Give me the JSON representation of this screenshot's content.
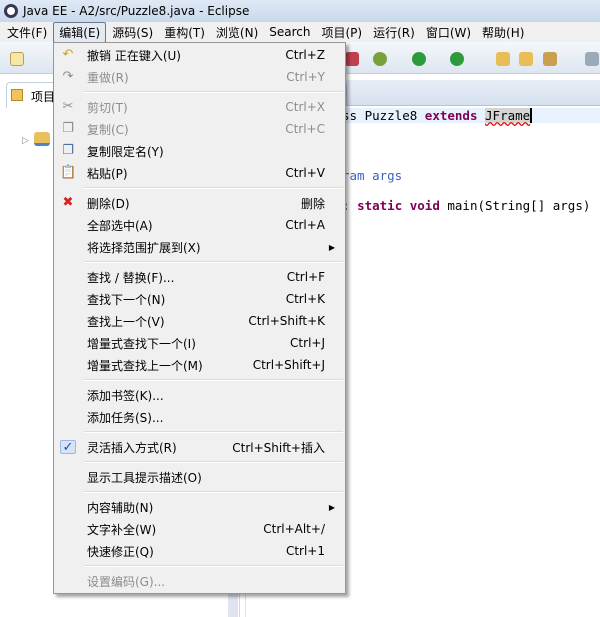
{
  "window": {
    "title": "Java EE  -  A2/src/Puzzle8.java  -  Eclipse"
  },
  "menubar": [
    "文件(F)",
    "编辑(E)",
    "源码(S)",
    "重构(T)",
    "浏览(N)",
    "Search",
    "项目(P)",
    "运行(R)",
    "窗口(W)",
    "帮助(H)"
  ],
  "active_menu": "编辑(E)",
  "left_panel": {
    "tab_label": "项目"
  },
  "editor": {
    "lines": [
      {
        "parts": [
          [
            "",
            "ss Puzzle8 "
          ],
          [
            "kw",
            "extends"
          ],
          [
            "",
            " "
          ],
          [
            "err",
            "JFrame"
          ]
        ],
        "highlight": true
      },
      {
        "parts": [
          [
            "jd",
            "ram args"
          ]
        ]
      },
      {
        "parts": [
          [
            "",
            ": "
          ],
          [
            "kw",
            "static void"
          ],
          [
            "",
            " main(String[] args)"
          ]
        ]
      }
    ]
  },
  "edit_menu": [
    {
      "label": "撤销 正在键入(U)",
      "shortcut": "Ctrl+Z",
      "icon": "undo-icon",
      "glyph": "↶",
      "color": "#d6a21b"
    },
    {
      "label": "重做(R)",
      "shortcut": "Ctrl+Y",
      "icon": "redo-icon",
      "glyph": "↷",
      "disabled": true
    },
    {
      "sep": true
    },
    {
      "label": "剪切(T)",
      "shortcut": "Ctrl+X",
      "icon": "cut-icon",
      "glyph": "✂",
      "disabled": true
    },
    {
      "label": "复制(C)",
      "shortcut": "Ctrl+C",
      "icon": "copy-icon",
      "glyph": "❐",
      "disabled": true
    },
    {
      "label": "复制限定名(Y)",
      "icon": "copy-qualified-name-icon",
      "glyph": "❐",
      "color": "#4a6fa5"
    },
    {
      "label": "粘贴(P)",
      "shortcut": "Ctrl+V",
      "icon": "paste-icon",
      "glyph": "📋",
      "color": "#a07a30"
    },
    {
      "sep": true
    },
    {
      "label": "删除(D)",
      "shortcut": "删除",
      "icon": "delete-icon",
      "glyph": "✖",
      "color": "#d62020"
    },
    {
      "label": "全部选中(A)",
      "shortcut": "Ctrl+A"
    },
    {
      "label": "将选择范围扩展到(X)",
      "submenu": true
    },
    {
      "sep": true
    },
    {
      "label": "查找 / 替换(F)...",
      "shortcut": "Ctrl+F"
    },
    {
      "label": "查找下一个(N)",
      "shortcut": "Ctrl+K"
    },
    {
      "label": "查找上一个(V)",
      "shortcut": "Ctrl+Shift+K"
    },
    {
      "label": "增量式查找下一个(I)",
      "shortcut": "Ctrl+J"
    },
    {
      "label": "增量式查找上一个(M)",
      "shortcut": "Ctrl+Shift+J"
    },
    {
      "sep": true
    },
    {
      "label": "添加书签(K)..."
    },
    {
      "label": "添加任务(S)..."
    },
    {
      "sep": true
    },
    {
      "label": "灵活插入方式(R)",
      "shortcut": "Ctrl+Shift+插入",
      "checked": true,
      "icon": "checkmark-icon",
      "glyph": "✓"
    },
    {
      "sep": true
    },
    {
      "label": "显示工具提示描述(O)"
    },
    {
      "sep": true
    },
    {
      "label": "内容辅助(N)",
      "submenu": true
    },
    {
      "label": "文字补全(W)",
      "shortcut": "Ctrl+Alt+/"
    },
    {
      "label": "快速修正(Q)",
      "shortcut": "Ctrl+1"
    },
    {
      "sep": true
    },
    {
      "label": "设置编码(G)...",
      "disabled": true
    }
  ]
}
